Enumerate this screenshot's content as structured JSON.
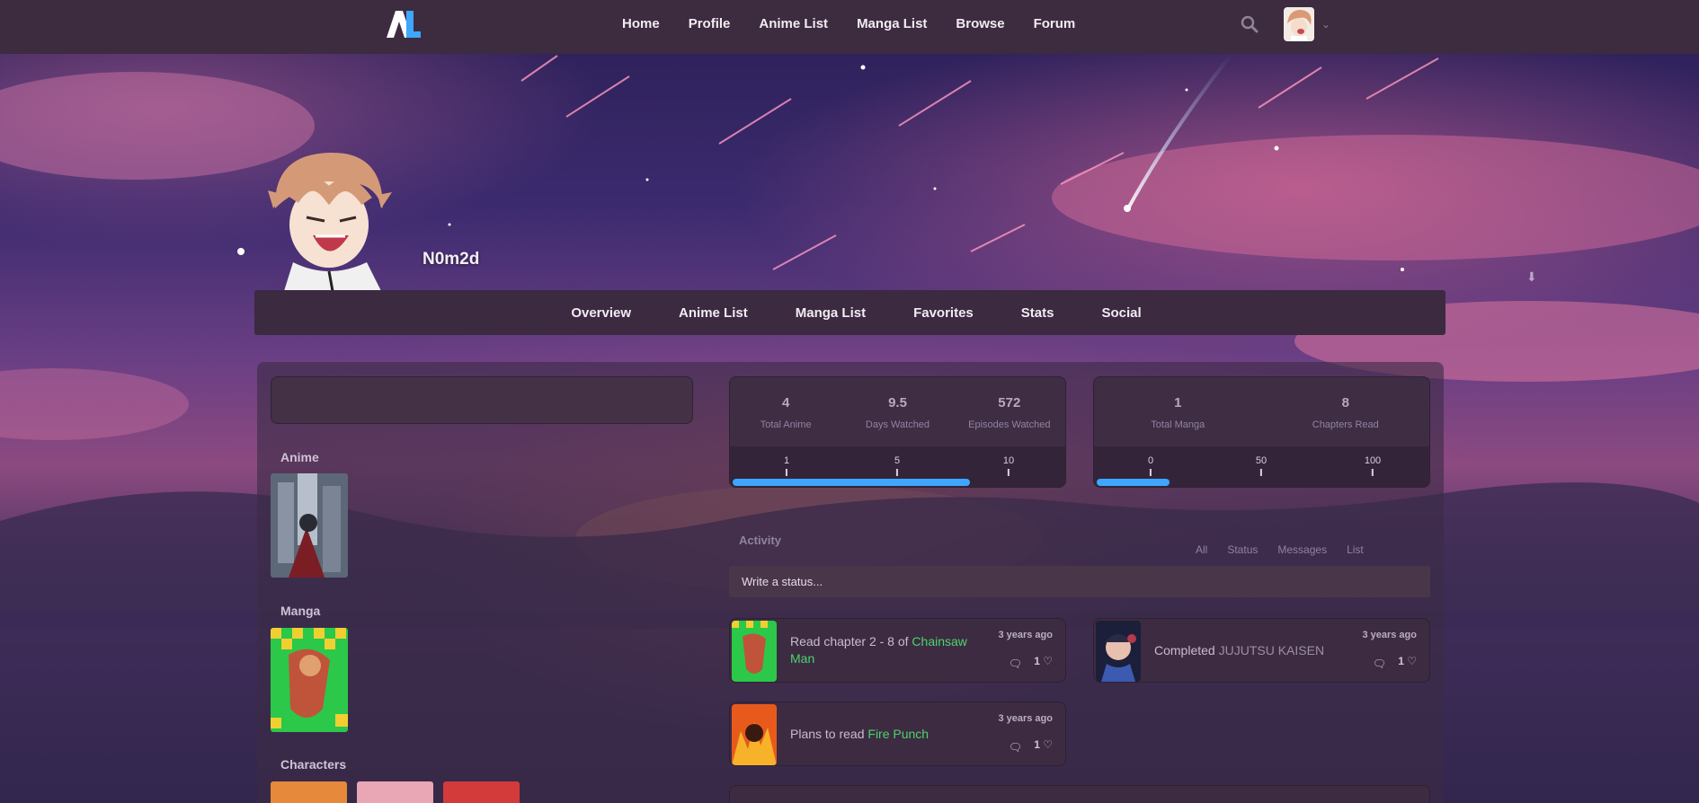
{
  "nav": {
    "links": [
      "Home",
      "Profile",
      "Anime List",
      "Manga List",
      "Browse",
      "Forum"
    ]
  },
  "profile": {
    "username": "N0m2d",
    "tabs": [
      "Overview",
      "Anime List",
      "Manga List",
      "Favorites",
      "Stats",
      "Social"
    ]
  },
  "favorites": {
    "anime_title": "Anime",
    "manga_title": "Manga",
    "characters_title": "Characters"
  },
  "anime_stats": {
    "total_anime": "4",
    "total_anime_label": "Total Anime",
    "days_watched": "9.5",
    "days_watched_label": "Days Watched",
    "episodes_watched": "572",
    "episodes_watched_label": "Episodes Watched",
    "ticks": [
      "1",
      "5",
      "10"
    ],
    "progress": 0.72
  },
  "manga_stats": {
    "total_manga": "1",
    "total_manga_label": "Total Manga",
    "chapters_read": "8",
    "chapters_read_label": "Chapters Read",
    "ticks": [
      "0",
      "50",
      "100"
    ],
    "progress": 0.22
  },
  "activity": {
    "title": "Activity",
    "filters": [
      "All",
      "Status",
      "Messages",
      "List"
    ],
    "status_placeholder": "Write a status...",
    "items": [
      {
        "prefix": "Read chapter 2 - 8 of ",
        "media": "Chainsaw Man",
        "time": "3 years ago",
        "replies": "",
        "likes": "1"
      },
      {
        "prefix": "Completed ",
        "media": "JUJUTSU KAISEN",
        "time": "3 years ago",
        "replies": "",
        "likes": "1"
      },
      {
        "prefix": "Plans to read ",
        "media": "Fire Punch",
        "time": "3 years ago",
        "replies": "",
        "likes": "1"
      }
    ]
  },
  "colors": {
    "nav_bg": "#3d2b3f",
    "accent_blue": "#3ea6ff",
    "link_green": "#4cd46b"
  },
  "icons": [
    "anilist-logo",
    "search-icon",
    "chevron-down-icon",
    "download-icon",
    "comment-icon",
    "heart-icon"
  ]
}
